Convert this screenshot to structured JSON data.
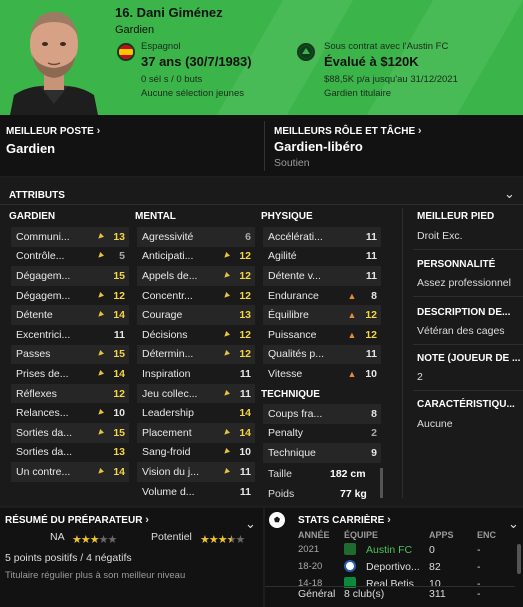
{
  "header": {
    "name": "16. Dani Giménez",
    "role": "Gardien",
    "nationality": "Espagnol",
    "age": "37 ans (30/7/1983)",
    "caps": "0 sél s / 0 buts",
    "youth": "Aucune sélection jeunes",
    "contract": "Sous contrat avec l'Austin FC",
    "value": "Évalué à $120K",
    "wage": "$88,5K p/a jusqu'au 31/12/2021",
    "status": "Gardien titulaire"
  },
  "info": {
    "best_pos_label": "MEILLEUR POSTE",
    "best_pos": "Gardien",
    "best_role_label": "MEILLEURS RÔLE ET TÂCHE",
    "best_role": "Gardien-libéro",
    "best_duty": "Soutien"
  },
  "attributes": {
    "title": "ATTRIBUTS",
    "gardien_title": "GARDIEN",
    "mental_title": "MENTAL",
    "physique_title": "PHYSIQUE",
    "technique_title": "TECHNIQUE",
    "gardien": [
      {
        "name": "Communi...",
        "val": "13",
        "arrow": "y"
      },
      {
        "name": "Contrôle...",
        "val": "5",
        "arrow": "y"
      },
      {
        "name": "Dégagem...",
        "val": "15",
        "arrow": ""
      },
      {
        "name": "Dégagem...",
        "val": "12",
        "arrow": "y"
      },
      {
        "name": "Détente",
        "val": "14",
        "arrow": "y"
      },
      {
        "name": "Excentrici...",
        "val": "11",
        "arrow": ""
      },
      {
        "name": "Passes",
        "val": "15",
        "arrow": "y"
      },
      {
        "name": "Prises de...",
        "val": "14",
        "arrow": "y"
      },
      {
        "name": "Réflexes",
        "val": "12",
        "arrow": ""
      },
      {
        "name": "Relances...",
        "val": "10",
        "arrow": "y"
      },
      {
        "name": "Sorties da...",
        "val": "15",
        "arrow": "y"
      },
      {
        "name": "Sorties da...",
        "val": "13",
        "arrow": ""
      },
      {
        "name": "Un contre...",
        "val": "14",
        "arrow": "y"
      }
    ],
    "mental": [
      {
        "name": "Agressivité",
        "val": "6",
        "arrow": ""
      },
      {
        "name": "Anticipati...",
        "val": "12",
        "arrow": "y"
      },
      {
        "name": "Appels de...",
        "val": "12",
        "arrow": "y"
      },
      {
        "name": "Concentr...",
        "val": "12",
        "arrow": "y"
      },
      {
        "name": "Courage",
        "val": "13",
        "arrow": ""
      },
      {
        "name": "Décisions",
        "val": "12",
        "arrow": "y"
      },
      {
        "name": "Détermin...",
        "val": "12",
        "arrow": "y"
      },
      {
        "name": "Inspiration",
        "val": "11",
        "arrow": ""
      },
      {
        "name": "Jeu collec...",
        "val": "11",
        "arrow": "y"
      },
      {
        "name": "Leadership",
        "val": "14",
        "arrow": ""
      },
      {
        "name": "Placement",
        "val": "14",
        "arrow": "y"
      },
      {
        "name": "Sang-froid",
        "val": "10",
        "arrow": "y"
      },
      {
        "name": "Vision du j...",
        "val": "11",
        "arrow": "y"
      },
      {
        "name": "Volume d...",
        "val": "11",
        "arrow": ""
      }
    ],
    "physique": [
      {
        "name": "Accélérati...",
        "val": "11",
        "arrow": ""
      },
      {
        "name": "Agilité",
        "val": "11",
        "arrow": ""
      },
      {
        "name": "Détente v...",
        "val": "11",
        "arrow": ""
      },
      {
        "name": "Endurance",
        "val": "8",
        "arrow": "o"
      },
      {
        "name": "Équilibre",
        "val": "12",
        "arrow": "o"
      },
      {
        "name": "Puissance",
        "val": "12",
        "arrow": "o"
      },
      {
        "name": "Qualités p...",
        "val": "11",
        "arrow": ""
      },
      {
        "name": "Vitesse",
        "val": "10",
        "arrow": "o"
      }
    ],
    "technique": [
      {
        "name": "Coups fra...",
        "val": "8",
        "arrow": ""
      },
      {
        "name": "Penalty",
        "val": "2",
        "arrow": ""
      },
      {
        "name": "Technique",
        "val": "9",
        "arrow": ""
      }
    ],
    "height_label": "Taille",
    "height": "182 cm",
    "weight_label": "Poids",
    "weight": "77 kg"
  },
  "side": {
    "foot_label": "MEILLEUR PIED",
    "foot": "Droit Exc.",
    "personality_label": "PERSONNALITÉ",
    "personality": "Assez professionnel",
    "media_label": "DESCRIPTION DE...",
    "media": "Vétéran des cages",
    "rating_label": "NOTE (JOUEUR DE ...",
    "rating": "2",
    "traits_label": "CARACTÉRISTIQU...",
    "traits": "Aucune"
  },
  "coach": {
    "title": "RÉSUMÉ DU PRÉPARATEUR",
    "na_label": "NA",
    "pot_label": "Potentiel",
    "na_stars": 3,
    "pot_stars": 3.5,
    "summary": "5 points positifs / 4 négatifs",
    "note": "Titulaire régulier plus à son meilleur niveau"
  },
  "career": {
    "title": "STATS CARRIÈRE",
    "col_year": "ANNÉE",
    "col_team": "ÉQUIPE",
    "col_apps": "APPS",
    "col_enc": "ENC",
    "rows": [
      {
        "year": "2021",
        "team": "Austin FC",
        "apps": "0",
        "enc": "-"
      },
      {
        "year": "18-20",
        "team": "Deportivo...",
        "apps": "82",
        "enc": "-"
      },
      {
        "year": "14-18",
        "team": "Real Betis",
        "apps": "10",
        "enc": "-"
      }
    ],
    "total_label": "Général",
    "total_clubs": "8 club(s)",
    "total_apps": "311",
    "total_enc": "-"
  },
  "colors": {
    "header_green": "#3bb54a",
    "accent_yellow": "#f5d742",
    "arrow_orange": "#e98a33"
  }
}
